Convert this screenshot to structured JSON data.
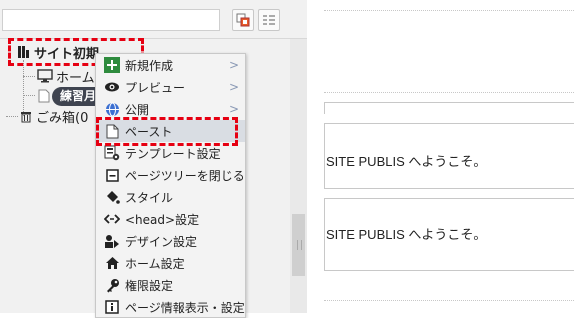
{
  "sidebar": {
    "search": {
      "value": "",
      "placeholder": ""
    },
    "toolbar": {
      "icon_a": "copy-grid-icon",
      "icon_b": "list-grid-icon"
    },
    "tree": {
      "site_label": "サイト初期",
      "home_label": "ホーム",
      "trash_label": "ごみ箱(0",
      "tooltip": "練習月"
    }
  },
  "context_menu": {
    "items": [
      {
        "label": "新規作成",
        "icon": "plus-icon",
        "submenu": ">"
      },
      {
        "label": "プレビュー",
        "icon": "eye-icon",
        "submenu": ">"
      },
      {
        "label": "公開",
        "icon": "globe-icon",
        "submenu": ">"
      },
      {
        "label": "ペースト",
        "icon": "paste-icon",
        "submenu": ""
      },
      {
        "label": "テンプレート設定",
        "icon": "template-icon",
        "submenu": ""
      },
      {
        "label": "ページツリーを閉じる",
        "icon": "collapse-icon",
        "submenu": ""
      },
      {
        "label": "スタイル",
        "icon": "paint-bucket-icon",
        "submenu": ""
      },
      {
        "label": "<head>設定",
        "icon": "code-icon",
        "submenu": ""
      },
      {
        "label": "デザイン設定",
        "icon": "design-icon",
        "submenu": ""
      },
      {
        "label": "ホーム設定",
        "icon": "home-icon",
        "submenu": ""
      },
      {
        "label": "権限設定",
        "icon": "key-icon",
        "submenu": ""
      },
      {
        "label": "ページ情報表示・設定",
        "icon": "info-icon",
        "submenu": ""
      }
    ],
    "highlighted": "ペースト"
  },
  "preview": {
    "welcome_1": "SITE PUBLIS へようこそ。",
    "welcome_2": "SITE PUBLIS へようこそ。"
  },
  "colors": {
    "annotation": "#e60012",
    "menu_bg": "#f3f3f3",
    "highlight": "#d9dde3"
  }
}
